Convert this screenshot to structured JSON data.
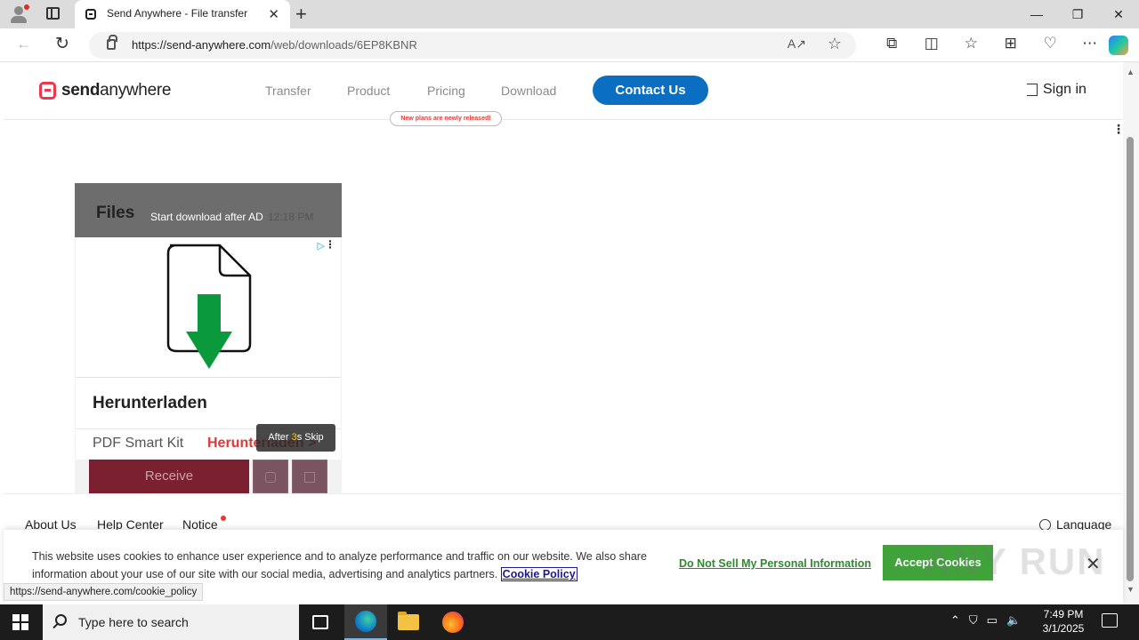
{
  "browser": {
    "tab_title": "Send Anywhere - File transfer",
    "tab_close": "✕",
    "new_tab": "+",
    "url_host": "https://send-anywhere.com",
    "url_path": "/web/downloads/6EP8KBNR",
    "window_controls": {
      "minimize": "—",
      "maximize": "❐",
      "close": "✕"
    }
  },
  "site": {
    "logo_bold": "send",
    "logo_rest": "anywhere",
    "nav": [
      "Transfer",
      "Product",
      "Pricing",
      "Download"
    ],
    "promo_badge": "New plans are newly released!",
    "contact_label": "Contact Us",
    "signin_label": "Sign in"
  },
  "card": {
    "title": "Files",
    "start_download": "Start download after AD",
    "time": "12:18 PM",
    "receive_label": "Receive"
  },
  "ad": {
    "headline": "Herunterladen",
    "advertiser": "PDF Smart Kit",
    "cta": "Herunterladen",
    "cta_arrow": ">",
    "skip_prefix": "After ",
    "skip_count": "3",
    "skip_suffix": "s Skip",
    "colors": {
      "arrow": "#0a9a3c"
    }
  },
  "footer": {
    "links": [
      "About Us",
      "Help Center",
      "Notice"
    ],
    "language": "Language"
  },
  "cookie": {
    "message": "This website uses cookies to enhance user experience and to analyze performance and traffic on our website. We also share information about your use of our site with our social media, advertising and analytics partners.",
    "policy_link": "Cookie Policy",
    "do_not_sell": "Do Not Sell My Personal Information",
    "accept": "Accept Cookies",
    "close": "✕"
  },
  "status_url": "https://send-anywhere.com/cookie_policy",
  "watermark": "ANY RUN",
  "taskbar": {
    "search_placeholder": "Type here to search",
    "time": "7:49 PM",
    "date": "3/1/2025"
  }
}
